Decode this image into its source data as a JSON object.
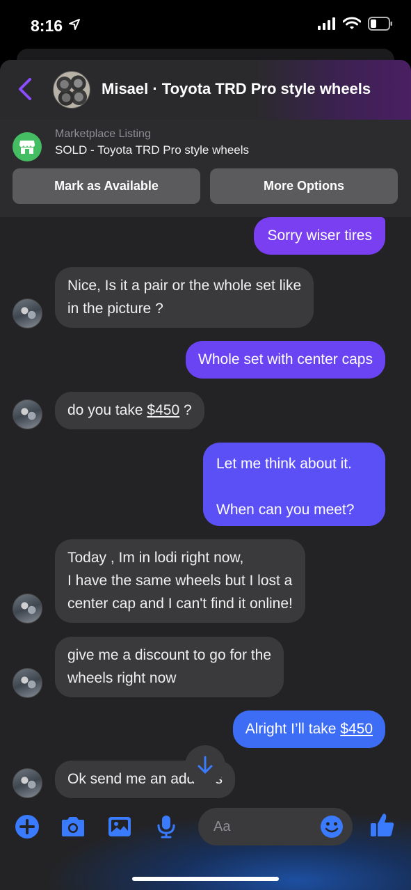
{
  "status_bar": {
    "time": "8:16"
  },
  "header": {
    "title": "Misael · Toyota TRD Pro style wheels"
  },
  "listing": {
    "caption": "Marketplace Listing",
    "title": "SOLD - Toyota TRD Pro style wheels",
    "mark_available_label": "Mark as Available",
    "more_options_label": "More Options"
  },
  "messages": [
    {
      "from": "me",
      "text": "Sorry wiser tires"
    },
    {
      "from": "them",
      "line1": "Nice, Is it a pair or the whole set like",
      "line2": "in the picture ?"
    },
    {
      "from": "me",
      "text": "Whole set with center caps"
    },
    {
      "from": "them",
      "prefix": "do you take ",
      "amount": "$450",
      "suffix": " ?"
    },
    {
      "from": "me",
      "line1": "Let me think about it.",
      "line2": "When can you meet?"
    },
    {
      "from": "them",
      "line1": "Today , Im in lodi right now,",
      "line2": "I have the same wheels but I lost a",
      "line3": "center cap and I can't find it online!"
    },
    {
      "from": "them",
      "line1": "give me a discount to go for the",
      "line2": "wheels right now"
    },
    {
      "from": "me",
      "prefix": "Alright I’ll take ",
      "amount": "$450"
    },
    {
      "from": "them",
      "text": "Ok send me an address"
    }
  ],
  "composer": {
    "placeholder": "Aa"
  },
  "colors": {
    "accent_purple": "#8a4dff",
    "bubble_purple": "#7a3ff0",
    "bubble_indigo": "#5f4df5",
    "bubble_blue": "#3d6cf5",
    "icon_blue": "#3a7bfd",
    "listing_green": "#45bd62"
  },
  "icons": [
    "location-arrow-icon",
    "signal-icon",
    "wifi-icon",
    "battery-icon",
    "back-chevron-icon",
    "marketplace-store-icon",
    "arrow-down-icon",
    "plus-icon",
    "camera-icon",
    "gallery-icon",
    "microphone-icon",
    "emoji-icon",
    "thumbs-up-icon"
  ]
}
